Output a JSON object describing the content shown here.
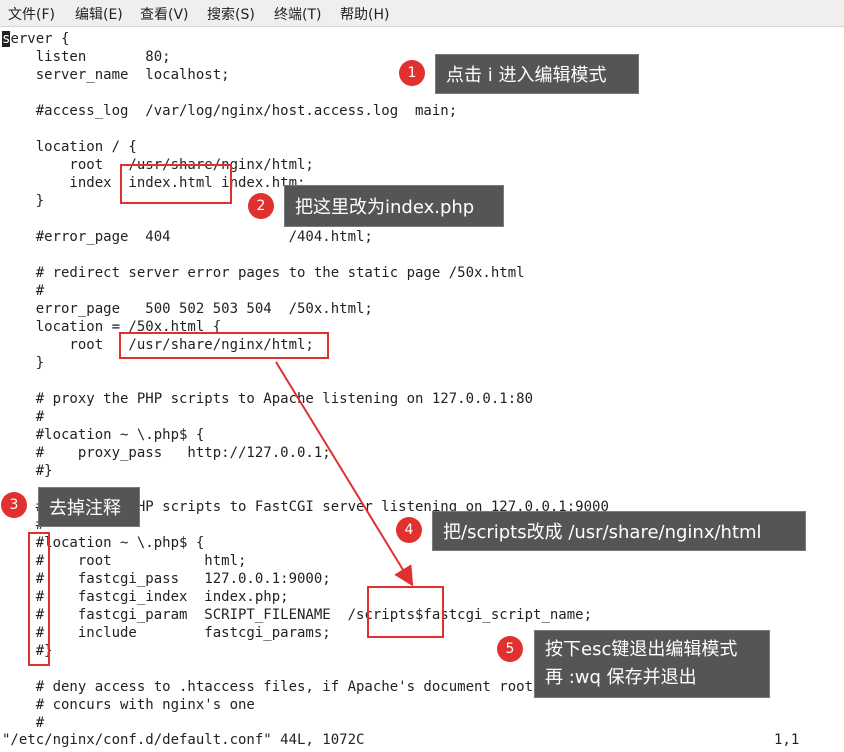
{
  "menubar": {
    "items": [
      "文件(F)",
      "编辑(E)",
      "查看(V)",
      "搜索(S)",
      "终端(T)",
      "帮助(H)"
    ]
  },
  "editor": {
    "cursor_char": "s",
    "lines": [
      "erver {",
      "    listen       80;",
      "    server_name  localhost;",
      "",
      "    #access_log  /var/log/nginx/host.access.log  main;",
      "",
      "    location / {",
      "        root   /usr/share/nginx/html;",
      "        index  index.html index.htm;",
      "    }",
      "",
      "    #error_page  404              /404.html;",
      "",
      "    # redirect server error pages to the static page /50x.html",
      "    #",
      "    error_page   500 502 503 504  /50x.html;",
      "    location = /50x.html {",
      "        root   /usr/share/nginx/html;",
      "    }",
      "",
      "    # proxy the PHP scripts to Apache listening on 127.0.0.1:80",
      "    #",
      "    #location ~ \\.php$ {",
      "    #    proxy_pass   http://127.0.0.1;",
      "    #}",
      "",
      "    # pass the PHP scripts to FastCGI server listening on 127.0.0.1:9000",
      "    #",
      "    #location ~ \\.php$ {",
      "    #    root           html;",
      "    #    fastcgi_pass   127.0.0.1:9000;",
      "    #    fastcgi_index  index.php;",
      "    #    fastcgi_param  SCRIPT_FILENAME  /scripts$fastcgi_script_name;",
      "    #    include        fastcgi_params;",
      "    #}",
      "",
      "    # deny access to .htaccess files, if Apache's document root",
      "    # concurs with nginx's one",
      "    #"
    ]
  },
  "status": {
    "file_info": "\"/etc/nginx/conf.d/default.conf\" 44L, 1072C",
    "position": "1,1"
  },
  "annotations": [
    {
      "number": "1",
      "text": "点击 i 进入编辑模式"
    },
    {
      "number": "2",
      "text": "把这里改为index.php"
    },
    {
      "number": "3",
      "text": "去掉注释"
    },
    {
      "number": "4",
      "text": "把/scripts改成 /usr/share/nginx/html"
    },
    {
      "number": "5",
      "line1": "按下esc键退出编辑模式",
      "line2": "再 :wq 保存并退出"
    }
  ],
  "colors": {
    "annotation_red": "#e03030",
    "callout_bg": "#555555"
  }
}
